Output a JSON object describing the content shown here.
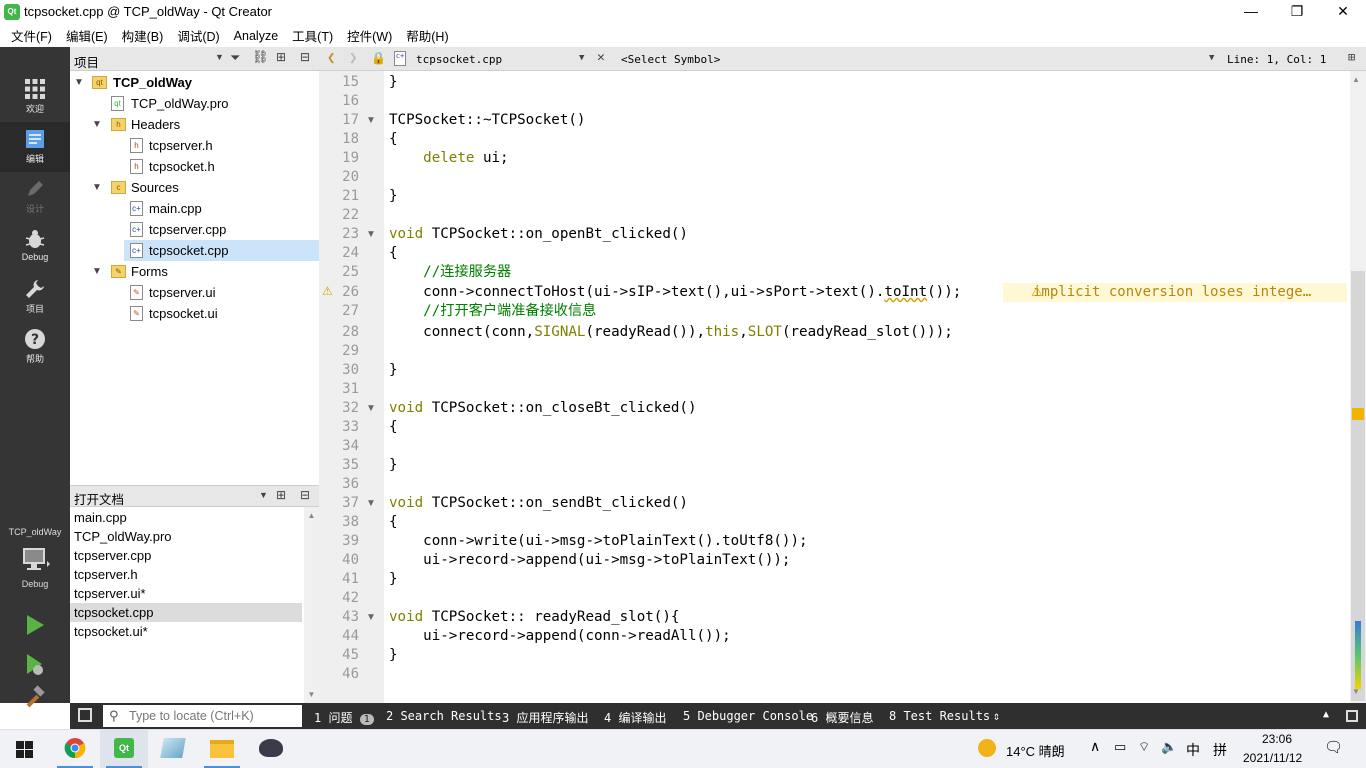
{
  "window": {
    "title": "tcpsocket.cpp @ TCP_oldWay - Qt Creator",
    "app_icon_label": "Qt",
    "minimize": "—",
    "maximize": "❐",
    "close": "✕"
  },
  "menu": [
    "文件(F)",
    "编辑(E)",
    "构建(B)",
    "调试(D)",
    "Analyze",
    "工具(T)",
    "控件(W)",
    "帮助(H)"
  ],
  "modes": [
    {
      "label": "欢迎",
      "icon": "grid-icon"
    },
    {
      "label": "编辑",
      "icon": "edit-doc-icon"
    },
    {
      "label": "设计",
      "icon": "pencil-icon"
    },
    {
      "label": "Debug",
      "icon": "bug-icon"
    },
    {
      "label": "项目",
      "icon": "wrench-icon"
    },
    {
      "label": "帮助",
      "icon": "help-icon"
    }
  ],
  "kit": {
    "project": "TCP_oldWay",
    "config": "Debug"
  },
  "project_panel": {
    "title": "项目",
    "tree": [
      {
        "label": "TCP_oldWay",
        "bold": true
      },
      {
        "label": "TCP_oldWay.pro"
      },
      {
        "label": "Headers"
      },
      {
        "label": "tcpserver.h"
      },
      {
        "label": "tcpsocket.h"
      },
      {
        "label": "Sources"
      },
      {
        "label": "main.cpp"
      },
      {
        "label": "tcpserver.cpp"
      },
      {
        "label": "tcpsocket.cpp"
      },
      {
        "label": "Forms"
      },
      {
        "label": "tcpserver.ui"
      },
      {
        "label": "tcpsocket.ui"
      }
    ]
  },
  "open_docs": {
    "title": "打开文档",
    "items": [
      "main.cpp",
      "TCP_oldWay.pro",
      "tcpserver.cpp",
      "tcpserver.h",
      "tcpserver.ui*",
      "tcpsocket.cpp",
      "tcpsocket.ui*"
    ]
  },
  "editor_toolbar": {
    "file": "tcpsocket.cpp",
    "symbol": "<Select Symbol>",
    "position": "Line: 1, Col: 1"
  },
  "editor": {
    "line_numbers": [
      "15",
      "16",
      "17",
      "18",
      "19",
      "20",
      "21",
      "22",
      "23",
      "24",
      "25",
      "26",
      "27",
      "28",
      "29",
      "30",
      "31",
      "32",
      "33",
      "34",
      "35",
      "36",
      "37",
      "38",
      "39",
      "40",
      "41",
      "42",
      "43",
      "44",
      "45",
      "46"
    ],
    "warning": "implicit conversion loses intege…"
  },
  "status": {
    "locate_placeholder": "Type to locate (Ctrl+K)",
    "tabs": [
      "1 问题",
      "2 Search Results",
      "3 应用程序输出",
      "4 编译输出",
      "5 Debugger Console",
      "6 概要信息",
      "8 Test Results"
    ],
    "issues_count": "1"
  },
  "taskbar": {
    "weather": "14°C 晴朗",
    "ime": "中",
    "ime2": "拼",
    "time": "23:06",
    "date": "2021/11/12"
  }
}
